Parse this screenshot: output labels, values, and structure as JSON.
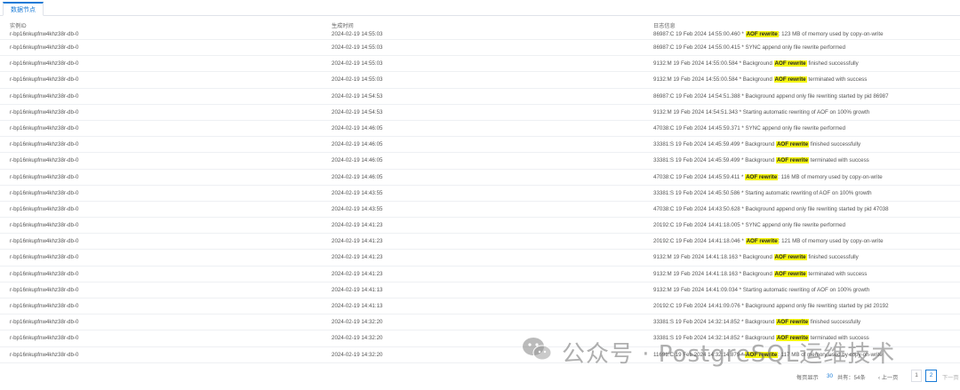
{
  "tabs": [
    {
      "label": "数据节点",
      "active": true
    }
  ],
  "table": {
    "columns": [
      "实例ID",
      "生成时间",
      "日志信息"
    ],
    "rows": [
      {
        "id": "r-bp16nkupfnw4khz38r-db-0",
        "time": "2024-02-19 14:55:03",
        "pre": "86987:C 19 Feb 2024 14:55:00.460 * ",
        "hl": "AOF rewrite",
        "post": ": 123 MB of memory used by copy-on-write"
      },
      {
        "id": "r-bp16nkupfnw4khz38r-db-0",
        "time": "2024-02-19 14:55:03",
        "pre": "86987:C 19 Feb 2024 14:55:00.415 * SYNC append only file rewrite performed",
        "hl": "",
        "post": ""
      },
      {
        "id": "r-bp16nkupfnw4khz38r-db-0",
        "time": "2024-02-19 14:55:03",
        "pre": "9132:M 19 Feb 2024 14:55:00.584 * Background ",
        "hl": "AOF rewrite",
        "post": " finished successfully"
      },
      {
        "id": "r-bp16nkupfnw4khz38r-db-0",
        "time": "2024-02-19 14:55:03",
        "pre": "9132:M 19 Feb 2024 14:55:00.584 * Background ",
        "hl": "AOF rewrite",
        "post": " terminated with success"
      },
      {
        "id": "r-bp16nkupfnw4khz38r-db-0",
        "time": "2024-02-19 14:54:53",
        "pre": "86987:C 19 Feb 2024 14:54:51.388 * Background append only file rewriting started by pid 86987",
        "hl": "",
        "post": ""
      },
      {
        "id": "r-bp16nkupfnw4khz38r-db-0",
        "time": "2024-02-19 14:54:53",
        "pre": "9132:M 19 Feb 2024 14:54:51.343 * Starting automatic rewriting of AOF on 100% growth",
        "hl": "",
        "post": ""
      },
      {
        "id": "r-bp16nkupfnw4khz38r-db-0",
        "time": "2024-02-19 14:46:05",
        "pre": "47038:C 19 Feb 2024 14:45:59.371 * SYNC append only file rewrite performed",
        "hl": "",
        "post": ""
      },
      {
        "id": "r-bp16nkupfnw4khz38r-db-0",
        "time": "2024-02-19 14:46:05",
        "pre": "33381:S 19 Feb 2024 14:45:59.499 * Background ",
        "hl": "AOF rewrite",
        "post": " finished successfully"
      },
      {
        "id": "r-bp16nkupfnw4khz38r-db-0",
        "time": "2024-02-19 14:46:05",
        "pre": "33381:S 19 Feb 2024 14:45:59.499 * Background ",
        "hl": "AOF rewrite",
        "post": " terminated with success"
      },
      {
        "id": "r-bp16nkupfnw4khz38r-db-0",
        "time": "2024-02-19 14:46:05",
        "pre": "47038:C 19 Feb 2024 14:45:59.411 * ",
        "hl": "AOF rewrite",
        "post": ": 116 MB of memory used by copy-on-write"
      },
      {
        "id": "r-bp16nkupfnw4khz38r-db-0",
        "time": "2024-02-19 14:43:55",
        "pre": "33381:S 19 Feb 2024 14:45:50.586 * Starting automatic rewriting of AOF on 100% growth",
        "hl": "",
        "post": ""
      },
      {
        "id": "r-bp16nkupfnw4khz38r-db-0",
        "time": "2024-02-19 14:43:55",
        "pre": "47038:C 19 Feb 2024 14:43:50.628 * Background append only file rewriting started by pid 47038",
        "hl": "",
        "post": ""
      },
      {
        "id": "r-bp16nkupfnw4khz38r-db-0",
        "time": "2024-02-19 14:41:23",
        "pre": "20192:C 19 Feb 2024 14:41:18.005 * SYNC append only file rewrite performed",
        "hl": "",
        "post": ""
      },
      {
        "id": "r-bp16nkupfnw4khz38r-db-0",
        "time": "2024-02-19 14:41:23",
        "pre": "20192:C 19 Feb 2024 14:41:18.046 * ",
        "hl": "AOF rewrite",
        "post": ": 121 MB of memory used by copy-on-write"
      },
      {
        "id": "r-bp16nkupfnw4khz38r-db-0",
        "time": "2024-02-19 14:41:23",
        "pre": "9132:M 19 Feb 2024 14:41:18.163 * Background ",
        "hl": "AOF rewrite",
        "post": " finished successfully"
      },
      {
        "id": "r-bp16nkupfnw4khz38r-db-0",
        "time": "2024-02-19 14:41:23",
        "pre": "9132:M 19 Feb 2024 14:41:18.163 * Background ",
        "hl": "AOF rewrite",
        "post": " terminated with success"
      },
      {
        "id": "r-bp16nkupfnw4khz38r-db-0",
        "time": "2024-02-19 14:41:13",
        "pre": "9132:M 19 Feb 2024 14:41:09.034 * Starting automatic rewriting of AOF on 100% growth",
        "hl": "",
        "post": ""
      },
      {
        "id": "r-bp16nkupfnw4khz38r-db-0",
        "time": "2024-02-19 14:41:13",
        "pre": "20192:C 19 Feb 2024 14:41:09.076 * Background append only file rewriting started by pid 20192",
        "hl": "",
        "post": ""
      },
      {
        "id": "r-bp16nkupfnw4khz38r-db-0",
        "time": "2024-02-19 14:32:20",
        "pre": "33381:S 19 Feb 2024 14:32:14.852 * Background ",
        "hl": "AOF rewrite",
        "post": " finished successfully"
      },
      {
        "id": "r-bp16nkupfnw4khz38r-db-0",
        "time": "2024-02-19 14:32:20",
        "pre": "33381:S 19 Feb 2024 14:32:14.852 * Background ",
        "hl": "AOF rewrite",
        "post": " terminated with success"
      },
      {
        "id": "r-bp16nkupfnw4khz38r-db-0",
        "time": "2024-02-19 14:32:20",
        "pre": "11691:C 19 Feb 2024 14:32:14.879 * ",
        "hl": "AOF rewrite",
        "post": ": 117 MB of memory used by copy-on-write"
      }
    ]
  },
  "pagination": {
    "per_page_label": "每页显示",
    "page_size": "30",
    "total_label": "共有：54条",
    "prev_label": "上一页",
    "pages": [
      "1",
      "2"
    ],
    "current_page": "2",
    "next_label": "下一页"
  },
  "watermark": {
    "text": "公众号 · PostgreSQL运维技术"
  },
  "colors": {
    "accent": "#1a7bd6",
    "highlight": "#f4f50f",
    "border": "#dfe3ea"
  }
}
